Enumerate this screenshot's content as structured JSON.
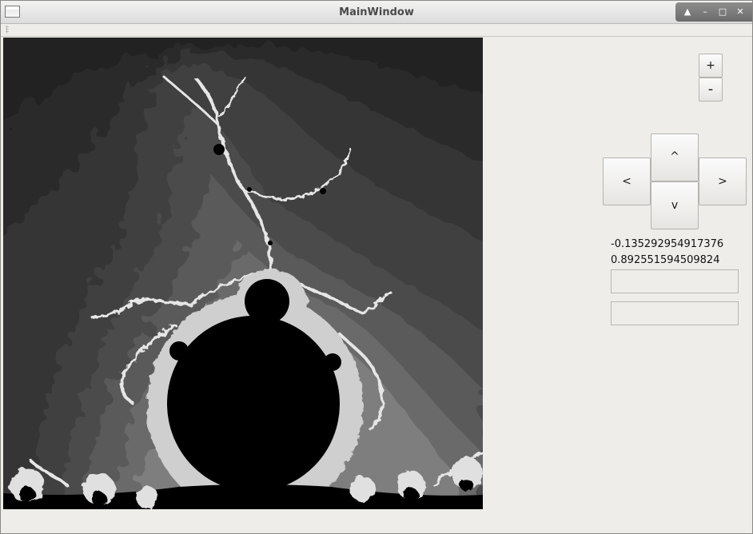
{
  "window": {
    "title": "MainWindow"
  },
  "canvas": {
    "name": "mandelbrot fractal view"
  },
  "zoom": {
    "in_label": "+",
    "out_label": "-"
  },
  "nav": {
    "up_label": "^",
    "left_label": "<",
    "right_label": ">",
    "down_label": "v"
  },
  "coords": {
    "re": "-0.135292954917376",
    "im": "0.892551594509824"
  },
  "inputs": {
    "field1_value": "",
    "field2_value": ""
  },
  "colors": {
    "titlebar": "#dcdcdc",
    "background": "#efedea",
    "fractal_fill": "#000000"
  }
}
